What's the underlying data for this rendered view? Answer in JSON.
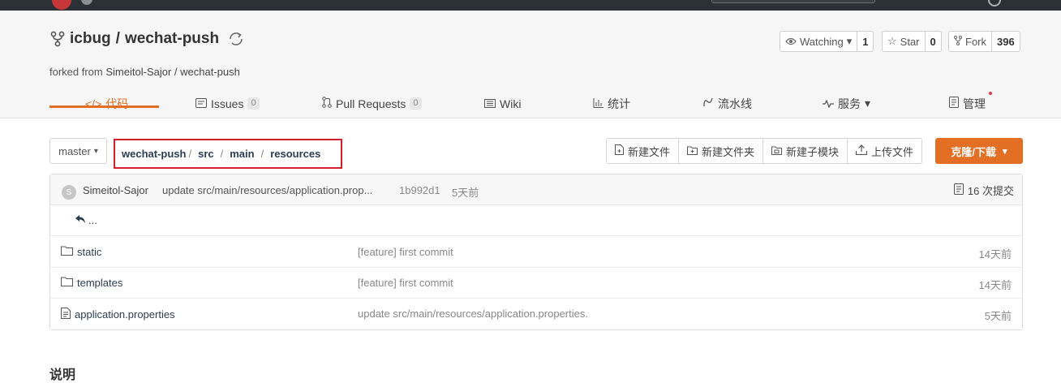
{
  "repo": {
    "owner": "icbug",
    "separator": "/",
    "name": "wechat-push",
    "forked_prefix": "forked from",
    "forked_source": "Simeitol-Sajor / wechat-push"
  },
  "stats": {
    "watch_label": "Watching",
    "watch_count": "1",
    "star_label": "Star",
    "star_count": "0",
    "fork_label": "Fork",
    "fork_count": "396"
  },
  "tabs": [
    {
      "label": "代码",
      "icon": "code-icon",
      "active": true
    },
    {
      "label": "Issues",
      "badge": "0",
      "icon": "issues-icon"
    },
    {
      "label": "Pull Requests",
      "badge": "0",
      "icon": "pull-request-icon"
    },
    {
      "label": "Wiki",
      "icon": "wiki-icon"
    },
    {
      "label": "统计",
      "icon": "stats-icon"
    },
    {
      "label": "流水线",
      "icon": "pipeline-icon"
    },
    {
      "label": "服务",
      "icon": "service-icon"
    },
    {
      "label": "管理",
      "icon": "manage-icon"
    }
  ],
  "branch": {
    "current": "master"
  },
  "breadcrumb": {
    "repo": "wechat-push",
    "p1": "src",
    "p2": "main",
    "p3": "resources",
    "sep": "/"
  },
  "actions": {
    "new_file": "新建文件",
    "new_folder": "新建文件夹",
    "new_submodule": "新建子模块",
    "upload": "上传文件",
    "clone": "克隆/下载"
  },
  "last_commit": {
    "avatar_letter": "S",
    "author": "Simeitol-Sajor",
    "message": "update src/main/resources/application.prop...",
    "sha": "1b992d1",
    "time": "5天前",
    "commit_count": "16 次提交"
  },
  "parent_dir": "...",
  "files": [
    {
      "name": "static",
      "type": "folder",
      "message": "[feature] first commit",
      "time": "14天前"
    },
    {
      "name": "templates",
      "type": "folder",
      "message": "[feature] first commit",
      "time": "14天前"
    },
    {
      "name": "application.properties",
      "type": "file",
      "message": "update src/main/resources/application.properties.",
      "time": "5天前"
    }
  ],
  "readme_title": "说明"
}
